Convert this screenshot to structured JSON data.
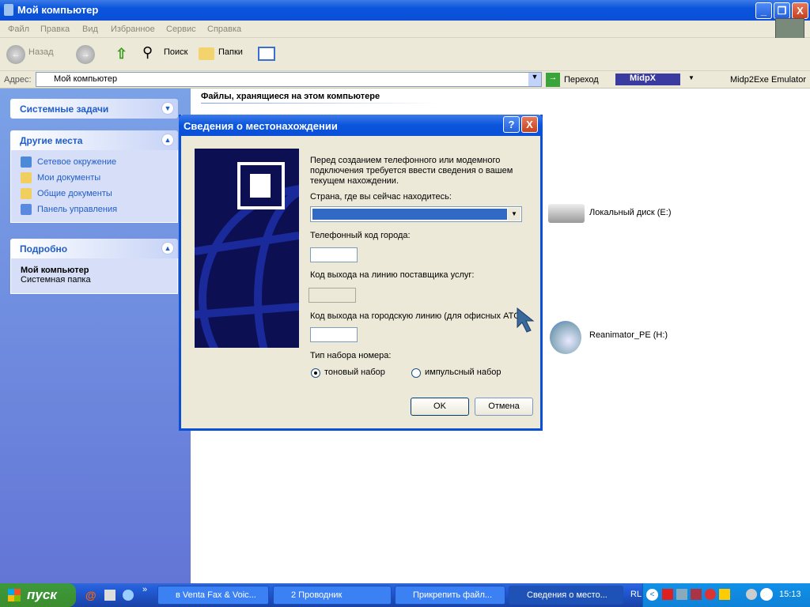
{
  "window": {
    "title": "Мой компьютер",
    "min": "_",
    "max": "❐",
    "close": "X"
  },
  "menu": [
    "Файл",
    "Правка",
    "Вид",
    "Избранное",
    "Сервис",
    "Справка"
  ],
  "toolbar": {
    "back": "Назад",
    "search": "Поиск",
    "folders": "Папки"
  },
  "address": {
    "label": "Адрес:",
    "value": "Мой компьютер",
    "go": "Переход",
    "midpx": "MidpX",
    "emulator": "Midp2Exe Emulator"
  },
  "sidebar": {
    "system_tasks": "Системные задачи",
    "other_places": {
      "title": "Другие места",
      "items": [
        "Сетевое окружение",
        "Мои документы",
        "Общие документы",
        "Панель управления"
      ]
    },
    "details": {
      "title": "Подробно",
      "name": "Мой компьютер",
      "type": "Системная папка"
    }
  },
  "content": {
    "section_title": "Файлы, хранящиеся на этом компьютере",
    "drives": [
      "Локальный диск (E:)",
      "Reanimator_PE (H:)"
    ]
  },
  "dialog": {
    "title": "Сведения о местонахождении",
    "help": "?",
    "close": "X",
    "intro": "Перед созданием телефонного или модемного подключения требуется ввести сведения о вашем текущем нахождении.",
    "country_label": "Страна, где вы сейчас находитесь:",
    "country_value": "",
    "area_code_label": "Телефонный код города:",
    "carrier_label": "Код выхода на линию поставщика услуг:",
    "outside_label": "Код выхода на городскую линию (для офисных АТС):",
    "dial_type_label": "Тип набора номера:",
    "tone": "тоновый набор",
    "pulse": "импульсный набор",
    "selected": "tone",
    "ok": "OK",
    "cancel": "Отмена"
  },
  "taskbar": {
    "start": "пуск",
    "tasks": [
      "в Venta Fax & Voic...",
      "2 Проводник",
      "Прикрепить файл...",
      "Сведения о место..."
    ],
    "lang": "RL",
    "clock": "15:13",
    "chevron": "»"
  }
}
